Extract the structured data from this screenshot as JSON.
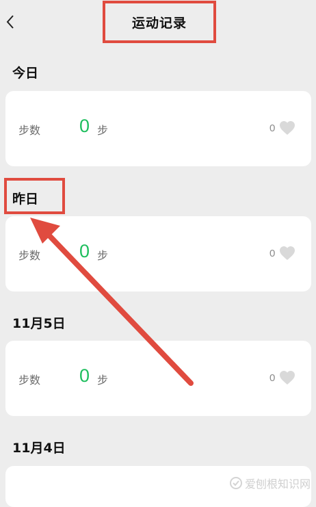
{
  "header": {
    "title": "运动记录",
    "back_icon": "chevron-left-icon"
  },
  "sections": [
    {
      "label": "今日",
      "card": {
        "steps_label": "步数",
        "steps_value": "0",
        "steps_unit": "步",
        "likes": "0"
      }
    },
    {
      "label": "昨日",
      "card": {
        "steps_label": "步数",
        "steps_value": "0",
        "steps_unit": "步",
        "likes": "0"
      }
    },
    {
      "label": "11月5日",
      "card": {
        "steps_label": "步数",
        "steps_value": "0",
        "steps_unit": "步",
        "likes": "0"
      }
    },
    {
      "label": "11月4日"
    }
  ],
  "colors": {
    "accent_green": "#1fbe5e",
    "annotation_red": "#e04b3f",
    "background": "#ededed"
  },
  "watermark": {
    "text": "爱刨根知识网",
    "icon": "watermark-logo-icon"
  }
}
